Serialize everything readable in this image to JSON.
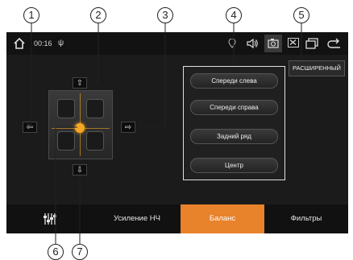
{
  "callouts": [
    "1",
    "2",
    "3",
    "4",
    "5",
    "6",
    "7"
  ],
  "status_bar": {
    "home_icon": "home-icon",
    "time": "00:16",
    "usb_icon": "usb-icon",
    "icons": [
      "location-icon",
      "volume-icon",
      "camera-icon",
      "close-box-icon",
      "window-icon",
      "back-icon"
    ]
  },
  "balance": {
    "up_arrow": "⇧",
    "down_arrow": "⇩",
    "left_arrow": "⇦",
    "right_arrow": "⇨"
  },
  "speaker_panel": {
    "buttons": [
      "Спереди слева",
      "Спереди справа",
      "Задний ряд",
      "Центр"
    ]
  },
  "advanced_button": "РАСШИРЕННЫЙ",
  "bottom_nav": {
    "tabs": [
      {
        "label": ""
      },
      {
        "label": "Усиление НЧ"
      },
      {
        "label": "Баланс"
      },
      {
        "label": "Фильтры"
      }
    ],
    "active_index": 2
  },
  "colors": {
    "accent": "#e8822b",
    "dot": "#f5a623",
    "screen_bg": "#1b1b1b"
  }
}
